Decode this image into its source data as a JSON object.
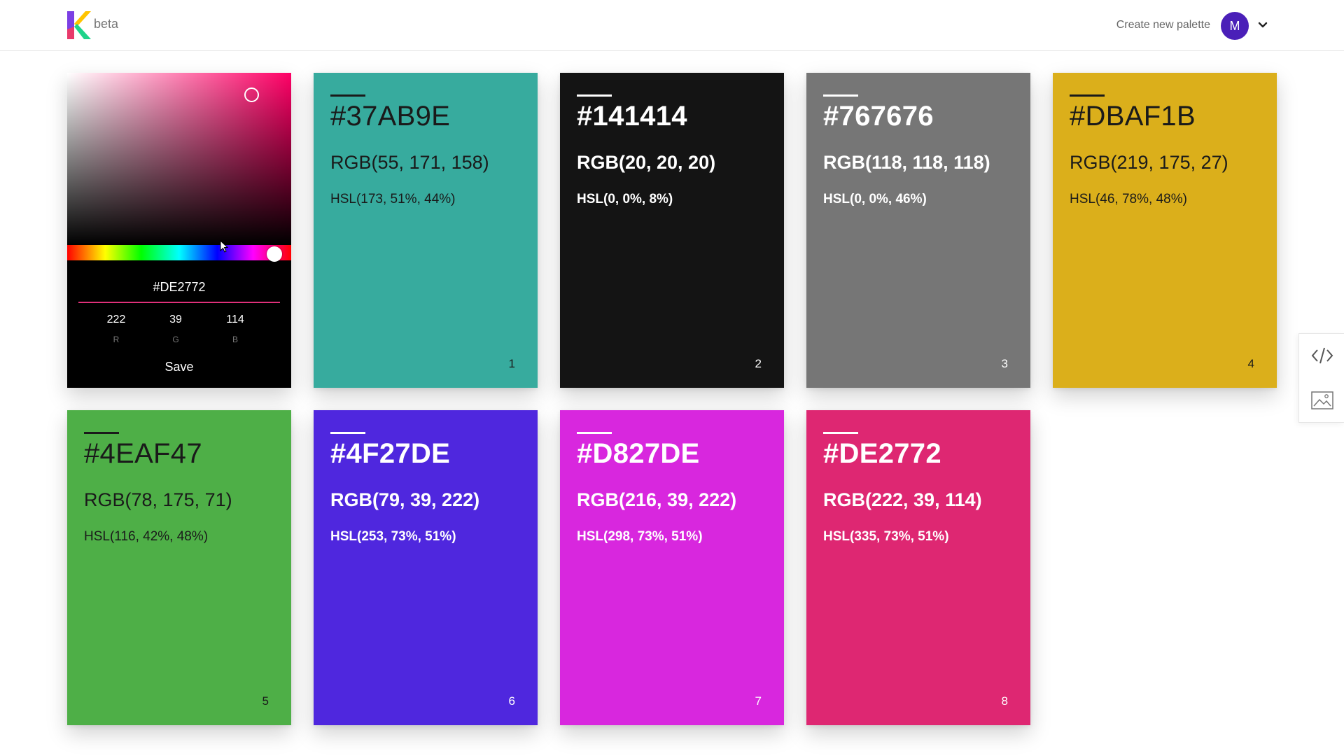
{
  "header": {
    "beta_label": "beta",
    "create_label": "Create new palette",
    "avatar_initial": "M",
    "avatar_color": "#4a1fb8"
  },
  "picker": {
    "hex_value": "#DE2772",
    "hue_color": "#ff0066",
    "channels": [
      {
        "value": "222",
        "label": "R"
      },
      {
        "value": "39",
        "label": "G"
      },
      {
        "value": "114",
        "label": "B"
      }
    ],
    "save_label": "Save"
  },
  "cards": [
    {
      "hex": "#37AB9E",
      "rgb": "RGB(55, 171, 158)",
      "hsl": "HSL(173, 51%, 44%)",
      "num": "1",
      "color": "#37AB9E",
      "theme": "light"
    },
    {
      "hex": "#141414",
      "rgb": "RGB(20, 20, 20)",
      "hsl": "HSL(0, 0%, 8%)",
      "num": "2",
      "color": "#141414",
      "theme": "dark"
    },
    {
      "hex": "#767676",
      "rgb": "RGB(118, 118, 118)",
      "hsl": "HSL(0, 0%, 46%)",
      "num": "3",
      "color": "#767676",
      "theme": "dark"
    },
    {
      "hex": "#DBAF1B",
      "rgb": "RGB(219, 175, 27)",
      "hsl": "HSL(46, 78%, 48%)",
      "num": "4",
      "color": "#DBAF1B",
      "theme": "light"
    },
    {
      "hex": "#4EAF47",
      "rgb": "RGB(78, 175, 71)",
      "hsl": "HSL(116, 42%, 48%)",
      "num": "5",
      "color": "#4EAF47",
      "theme": "light"
    },
    {
      "hex": "#4F27DE",
      "rgb": "RGB(79, 39, 222)",
      "hsl": "HSL(253, 73%, 51%)",
      "num": "6",
      "color": "#4F27DE",
      "theme": "dark"
    },
    {
      "hex": "#D827DE",
      "rgb": "RGB(216, 39, 222)",
      "hsl": "HSL(298, 73%, 51%)",
      "num": "7",
      "color": "#D827DE",
      "theme": "dark"
    },
    {
      "hex": "#DE2772",
      "rgb": "RGB(222, 39, 114)",
      "hsl": "HSL(335, 73%, 51%)",
      "num": "8",
      "color": "#DE2772",
      "theme": "dark"
    }
  ],
  "side_panel": {
    "icons": [
      "code-icon",
      "image-icon"
    ]
  }
}
